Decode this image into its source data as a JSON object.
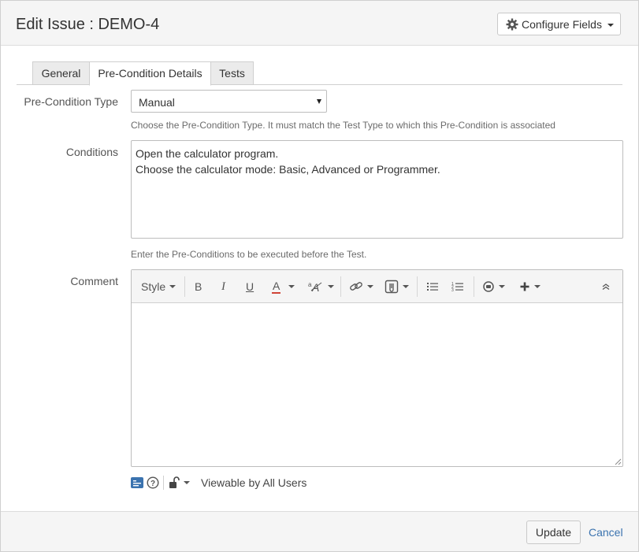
{
  "dialog": {
    "title": "Edit Issue : DEMO-4",
    "configure_fields_label": "Configure Fields"
  },
  "tabs": [
    {
      "label": "General",
      "active": false
    },
    {
      "label": "Pre-Condition Details",
      "active": true
    },
    {
      "label": "Tests",
      "active": false
    }
  ],
  "fields": {
    "precondition_type": {
      "label": "Pre-Condition Type",
      "value": "Manual",
      "help": "Choose the Pre-Condition Type. It must match the Test Type to which this Pre-Condition is associated"
    },
    "conditions": {
      "label": "Conditions",
      "lines": [
        "Open the calculator program.",
        "Choose the calculator mode: Basic, Advanced or Programmer."
      ],
      "help": "Enter the Pre-Conditions to be executed before the Test."
    },
    "comment": {
      "label": "Comment",
      "toolbar": {
        "style_label": "Style",
        "bold": "B",
        "italic": "I",
        "underline": "U",
        "text_color": "A",
        "text_color_underline": "#d04437"
      },
      "visibility": "Viewable by All Users"
    }
  },
  "footer": {
    "update_label": "Update",
    "cancel_label": "Cancel"
  }
}
